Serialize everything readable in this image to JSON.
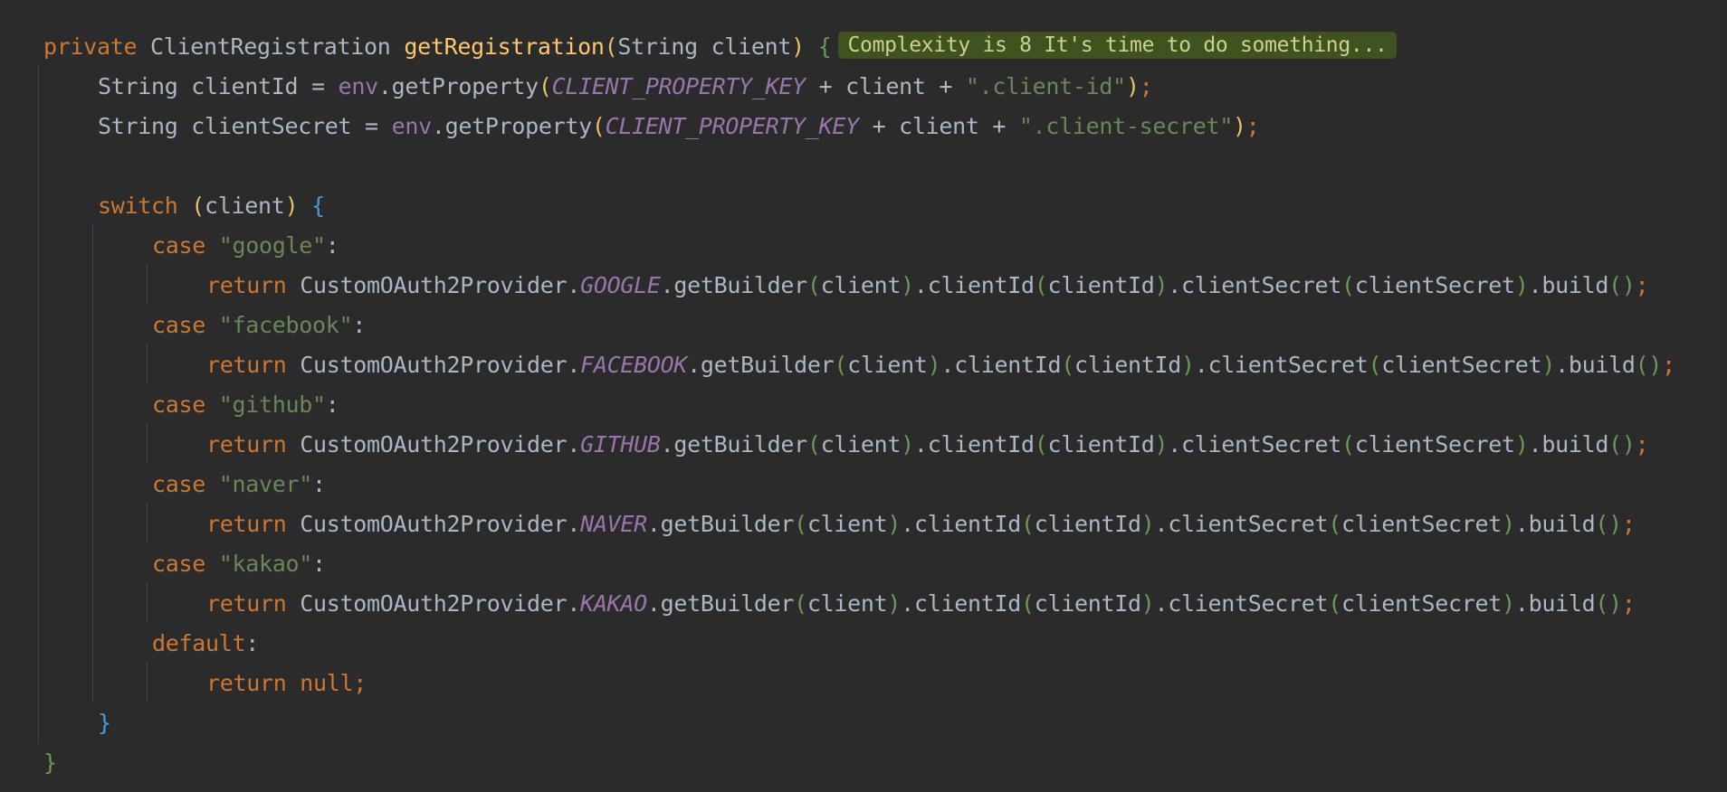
{
  "code": {
    "method_signature": {
      "modifier": "private",
      "return_type": "ClientRegistration",
      "method_name": "getRegistration",
      "param_type": "String",
      "param_name": "client"
    },
    "complexity_hint": "Complexity is 8 It's time to do something...",
    "line_client_id": {
      "type": "String",
      "var": "clientId",
      "env": "env",
      "call": "getProperty",
      "constant": "CLIENT_PROPERTY_KEY",
      "literal": "\".client-id\""
    },
    "line_client_secret": {
      "type": "String",
      "var": "clientSecret",
      "env": "env",
      "call": "getProperty",
      "constant": "CLIENT_PROPERTY_KEY",
      "literal": "\".client-secret\""
    },
    "switch_keyword": "switch",
    "switch_subject": "client",
    "cases": [
      {
        "label": "\"google\"",
        "provider_const": "GOOGLE"
      },
      {
        "label": "\"facebook\"",
        "provider_const": "FACEBOOK"
      },
      {
        "label": "\"github\"",
        "provider_const": "GITHUB"
      },
      {
        "label": "\"naver\"",
        "provider_const": "NAVER"
      },
      {
        "label": "\"kakao\"",
        "provider_const": "KAKAO"
      }
    ],
    "keywords": {
      "case": "case",
      "return": "return",
      "default": "default",
      "null": "null"
    },
    "provider_class": "CustomOAuth2Provider",
    "chain": {
      "get_builder": "getBuilder",
      "client_id": "clientId",
      "client_secret": "clientSecret",
      "build": "build"
    }
  },
  "theme": {
    "background": "#2b2b2b",
    "keyword": "#cc7832",
    "function": "#ffc66d",
    "string": "#6a8759",
    "constant": "#9876aa",
    "text": "#a9b7c6",
    "hint_background": "#3f5220"
  }
}
